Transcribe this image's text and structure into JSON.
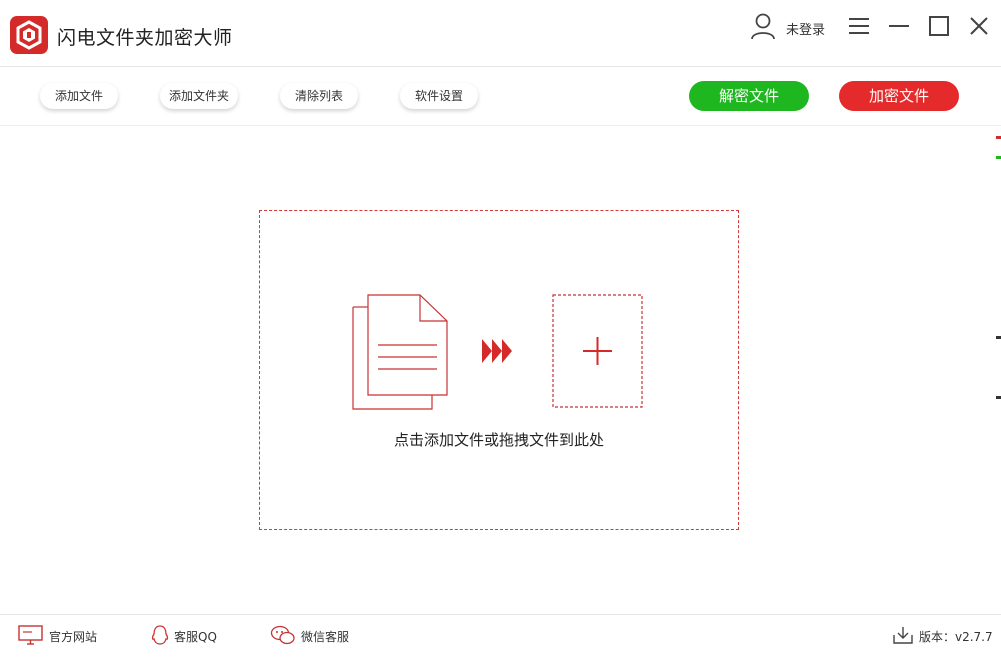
{
  "app": {
    "title": "闪电文件夹加密大师",
    "user_label": "未登录",
    "logo_icon": "shield-logo-icon"
  },
  "window_controls": [
    "menu-icon",
    "minimize-icon",
    "maximize-icon",
    "close-icon"
  ],
  "toolbar": {
    "add_file": "添加文件",
    "add_folder": "添加文件夹",
    "clear_list": "清除列表",
    "settings": "软件设置",
    "decrypt": "解密文件",
    "encrypt": "加密文件"
  },
  "dropzone": {
    "text": "点击添加文件或拖拽文件到此处"
  },
  "footer": {
    "website": "官方网站",
    "qq_support": "客服QQ",
    "wechat_support": "微信客服",
    "version": "版本：v2.7.7"
  },
  "colors": {
    "accent_red": "#e42a2a",
    "accent_green": "#1fb71f",
    "dashed_border": "#d23a3a"
  }
}
